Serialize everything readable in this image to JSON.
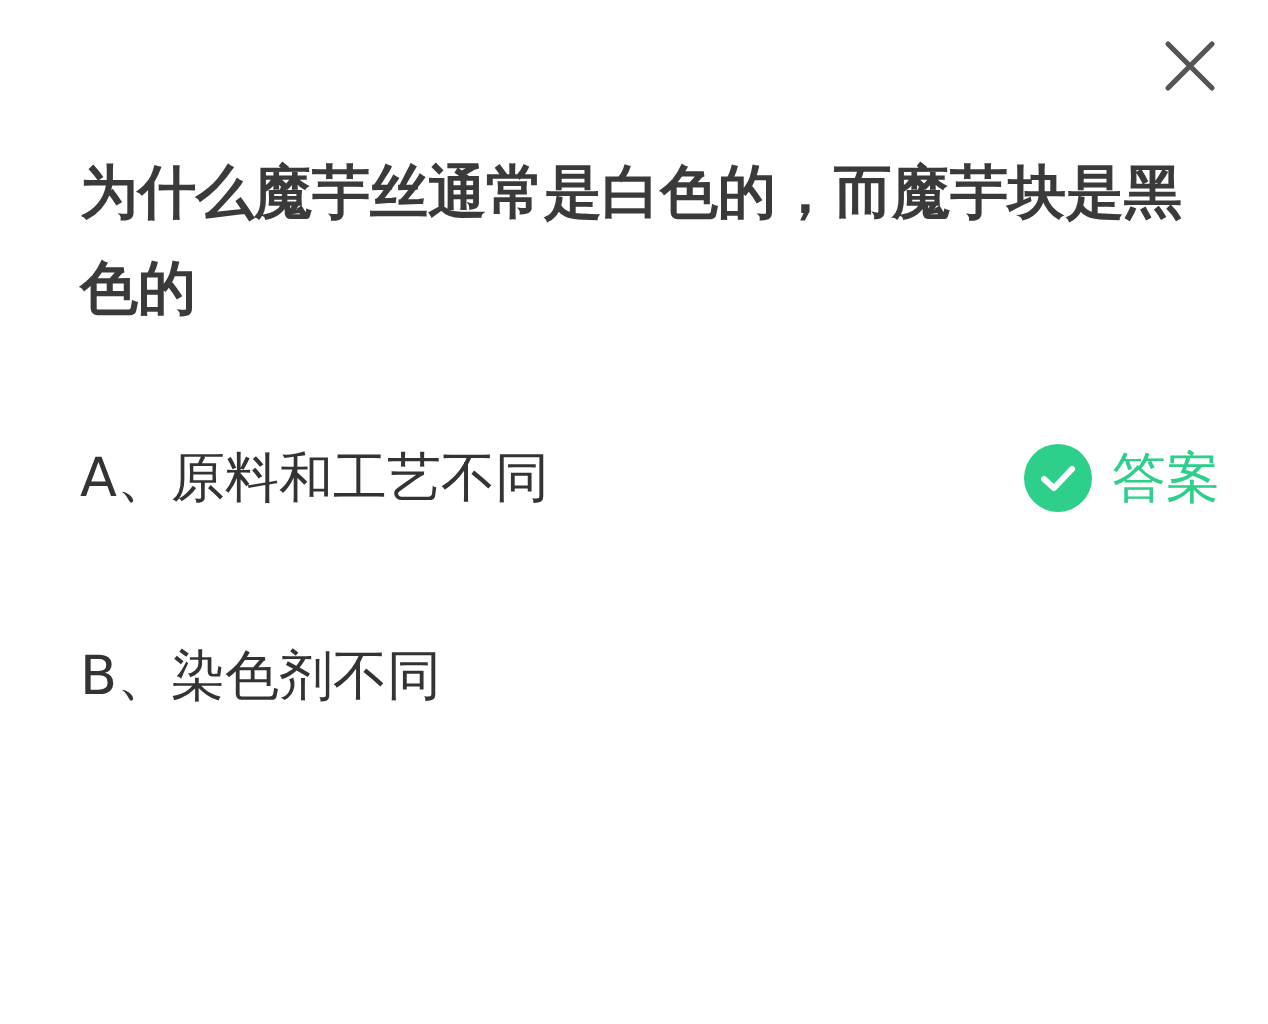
{
  "question": "为什么魔芋丝通常是白色的，而魔芋块是黑色的",
  "options": [
    {
      "text": "A、原料和工艺不同",
      "correct": true
    },
    {
      "text": "B、染色剂不同",
      "correct": false
    }
  ],
  "answer_label": "答案"
}
